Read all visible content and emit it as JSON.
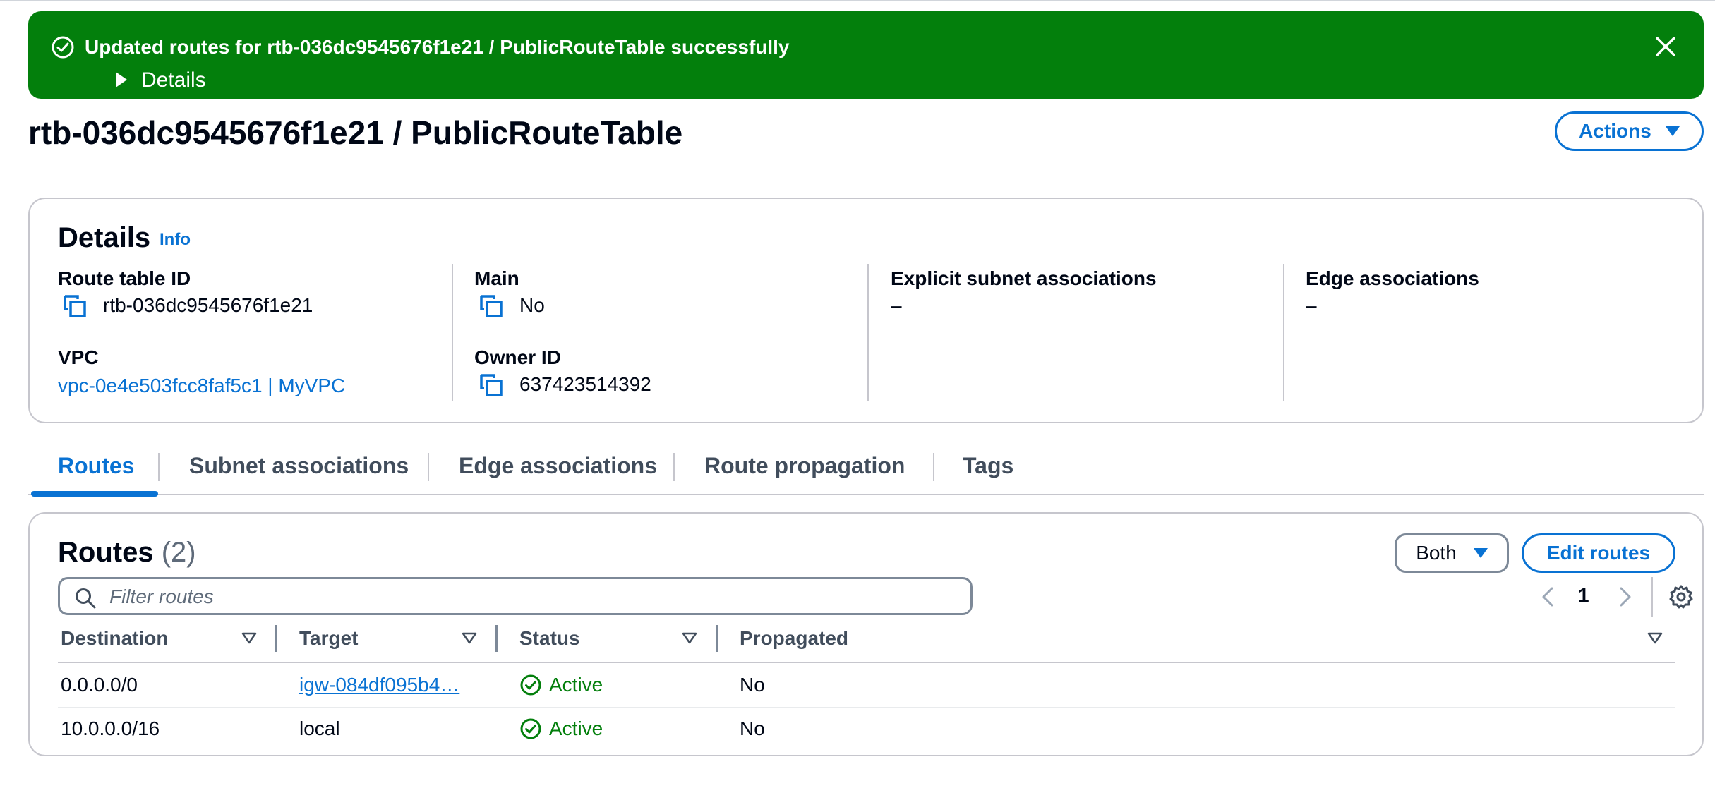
{
  "flash": {
    "message": "Updated routes for rtb-036dc9545676f1e21 / PublicRouteTable successfully",
    "details_label": "Details",
    "color": "#037f0c"
  },
  "header": {
    "title": "rtb-036dc9545676f1e21 / PublicRouteTable",
    "actions_label": "Actions"
  },
  "details": {
    "heading": "Details",
    "info_label": "Info",
    "route_table_id_label": "Route table ID",
    "route_table_id": "rtb-036dc9545676f1e21",
    "vpc_label": "VPC",
    "vpc_value": "vpc-0e4e503fcc8faf5c1 | MyVPC",
    "main_label": "Main",
    "main_value": "No",
    "owner_id_label": "Owner ID",
    "owner_id": "637423514392",
    "explicit_subnet_label": "Explicit subnet associations",
    "explicit_subnet_value": "–",
    "edge_assoc_label": "Edge associations",
    "edge_assoc_value": "–"
  },
  "tabs": [
    {
      "label": "Routes",
      "active": true
    },
    {
      "label": "Subnet associations",
      "active": false
    },
    {
      "label": "Edge associations",
      "active": false
    },
    {
      "label": "Route propagation",
      "active": false
    },
    {
      "label": "Tags",
      "active": false
    }
  ],
  "routes": {
    "title": "Routes",
    "count": "(2)",
    "filter_select": "Both",
    "edit_label": "Edit routes",
    "search_placeholder": "Filter routes",
    "page": "1",
    "columns": [
      "Destination",
      "Target",
      "Status",
      "Propagated"
    ],
    "rows": [
      {
        "destination": "0.0.0.0/0",
        "target": "igw-084df095b4…",
        "status": "Active",
        "propagated": "No"
      },
      {
        "destination": "10.0.0.0/16",
        "target": "local",
        "status": "Active",
        "propagated": "No"
      }
    ]
  },
  "colors": {
    "accent": "#0972d3",
    "success": "#037f0c",
    "border": "#c6c6cd"
  }
}
